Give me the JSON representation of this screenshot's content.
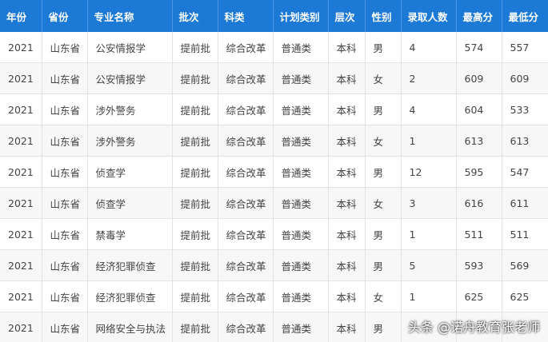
{
  "table": {
    "headers": [
      "年份",
      "省份",
      "专业名称",
      "批次",
      "科类",
      "计划类别",
      "层次",
      "性别",
      "录取人数",
      "最高分",
      "最低分"
    ],
    "rows": [
      [
        "2021",
        "山东省",
        "公安情报学",
        "提前批",
        "综合改革",
        "普通类",
        "本科",
        "男",
        "4",
        "574",
        "557"
      ],
      [
        "2021",
        "山东省",
        "公安情报学",
        "提前批",
        "综合改革",
        "普通类",
        "本科",
        "女",
        "2",
        "609",
        "609"
      ],
      [
        "2021",
        "山东省",
        "涉外警务",
        "提前批",
        "综合改革",
        "普通类",
        "本科",
        "男",
        "4",
        "604",
        "533"
      ],
      [
        "2021",
        "山东省",
        "涉外警务",
        "提前批",
        "综合改革",
        "普通类",
        "本科",
        "女",
        "1",
        "613",
        "613"
      ],
      [
        "2021",
        "山东省",
        "侦查学",
        "提前批",
        "综合改革",
        "普通类",
        "本科",
        "男",
        "12",
        "595",
        "547"
      ],
      [
        "2021",
        "山东省",
        "侦查学",
        "提前批",
        "综合改革",
        "普通类",
        "本科",
        "女",
        "3",
        "616",
        "611"
      ],
      [
        "2021",
        "山东省",
        "禁毒学",
        "提前批",
        "综合改革",
        "普通类",
        "本科",
        "男",
        "1",
        "511",
        "511"
      ],
      [
        "2021",
        "山东省",
        "经济犯罪侦查",
        "提前批",
        "综合改革",
        "普通类",
        "本科",
        "男",
        "5",
        "593",
        "569"
      ],
      [
        "2021",
        "山东省",
        "经济犯罪侦查",
        "提前批",
        "综合改革",
        "普通类",
        "本科",
        "女",
        "1",
        "625",
        "625"
      ],
      [
        "2021",
        "山东省",
        "网络安全与执法",
        "提前批",
        "综合改革",
        "普通类",
        "本科",
        "男",
        "",
        "",
        ""
      ]
    ]
  },
  "watermark": "头条 @诺舟教育张老师",
  "colors": {
    "header_bg": "#1c79d6",
    "header_text": "#ffffff",
    "row_alt_bg": "#f7f7f7",
    "cell_text": "#444444"
  }
}
